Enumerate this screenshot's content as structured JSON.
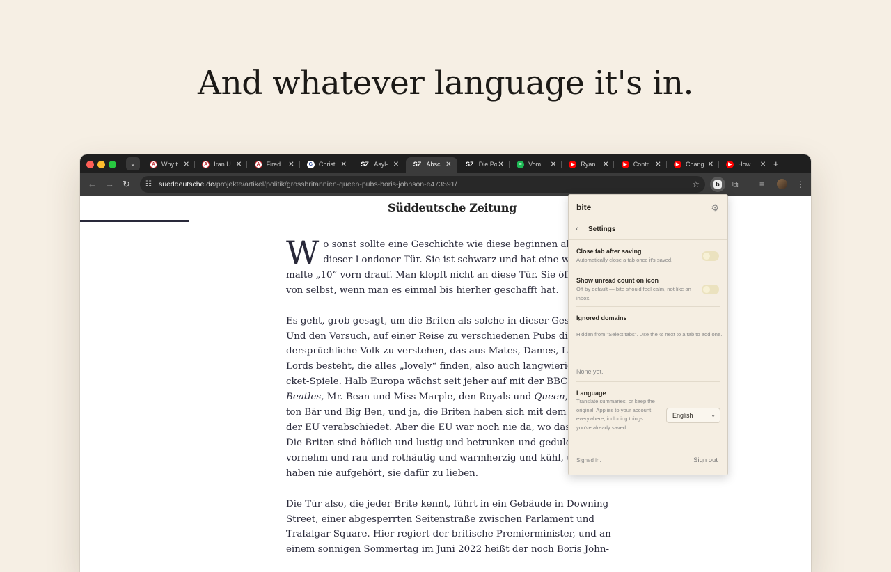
{
  "headline": "And whatever language it's in.",
  "browser": {
    "tabs": [
      {
        "title": "Why t",
        "icon": "sz-red-icon",
        "icon_color": "#c1272d",
        "glyph": "A"
      },
      {
        "title": "Iran U",
        "icon": "sz-red-icon",
        "icon_color": "#c1272d",
        "glyph": "A"
      },
      {
        "title": "Fired",
        "icon": "sz-red-icon",
        "icon_color": "#c1272d",
        "glyph": "A"
      },
      {
        "title": "Christ",
        "icon": "g-icon",
        "icon_color": "#2b4c9b",
        "glyph": "G"
      },
      {
        "title": "Asyl-",
        "icon": "sz-icon",
        "icon_color": "#ffffff",
        "glyph": "SZ"
      },
      {
        "title": "Abscl",
        "icon": "sz-icon",
        "icon_color": "#ffffff",
        "glyph": "SZ",
        "active": true
      },
      {
        "title": "Die Po",
        "icon": "sz-icon",
        "icon_color": "#ffffff",
        "glyph": "SZ"
      },
      {
        "title": "Vom",
        "icon": "spotify-icon",
        "icon_color": "#1db954",
        "glyph": "≡"
      },
      {
        "title": "Ryan",
        "icon": "youtube-icon",
        "icon_color": "#ff0000",
        "glyph": "▶"
      },
      {
        "title": "Contr",
        "icon": "youtube-icon",
        "icon_color": "#ff0000",
        "glyph": "▶"
      },
      {
        "title": "Chang",
        "icon": "youtube-icon",
        "icon_color": "#ff0000",
        "glyph": "▶"
      },
      {
        "title": "How",
        "icon": "youtube-icon",
        "icon_color": "#ff0000",
        "glyph": "▶"
      }
    ],
    "url_domain": "sueddeutsche.de",
    "url_path": "/projekte/artikel/politik/grossbritannien-queen-pubs-boris-johnson-e473591/"
  },
  "page": {
    "logo": "Süddeutsche Zeitung",
    "dropcap": "W",
    "paragraphs": [
      {
        "lines": [
          {
            "segs": [
              {
                "t": "o sonst sollte eine Geschichte wie diese beginnen als h"
              }
            ]
          },
          {
            "segs": [
              {
                "t": "dieser Londoner Tür. Sie ist schwarz und hat eine weiß"
              }
            ]
          },
          {
            "segs": [
              {
                "t": "malte „10“ vorn drauf. Man klopft nicht an diese Tür. Sie öffn"
              }
            ]
          },
          {
            "segs": [
              {
                "t": "von selbst, wenn man es einmal bis hierher geschafft hat."
              }
            ]
          }
        ]
      },
      {
        "lines": [
          {
            "segs": [
              {
                "t": "Es geht, grob gesagt, um die Briten als solche in dieser Geschi"
              }
            ]
          },
          {
            "segs": [
              {
                "t": "Und den Versuch, auf einer Reise zu verschiedenen Pubs diese"
              }
            ]
          },
          {
            "segs": [
              {
                "t": "dersprüchliche Volk zu verstehen, das aus Mates, Dames, Lad"
              }
            ]
          },
          {
            "segs": [
              {
                "t": "Lords besteht, die alles „lovely“ finden, also auch langwierige"
              }
            ]
          },
          {
            "segs": [
              {
                "t": "cket-Spiele. Halb Europa wächst seit jeher auf mit der BBC un"
              }
            ]
          },
          {
            "segs": [
              {
                "t": "Beatles",
                "i": true
              },
              {
                "t": ", Mr. Bean und Miss Marple, den Royals und "
              },
              {
                "t": "Queen",
                "i": true
              },
              {
                "t": ", Pa"
              }
            ]
          },
          {
            "segs": [
              {
                "t": "ton Bär und Big Ben, und ja, die Briten haben sich mit dem Br"
              }
            ]
          },
          {
            "segs": [
              {
                "t": "der EU verabschiedet. Aber die EU war noch nie da, wo das He"
              }
            ]
          },
          {
            "segs": [
              {
                "t": "Die Briten sind höflich und lustig und betrunken und geduldi"
              }
            ]
          },
          {
            "segs": [
              {
                "t": "vornehm und rau und rothäutig und warmherzig und kühl, u"
              }
            ]
          },
          {
            "segs": [
              {
                "t": "haben nie aufgehört, sie dafür zu lieben."
              }
            ]
          }
        ]
      },
      {
        "lines": [
          {
            "segs": [
              {
                "t": "Die Tür also, die jeder Brite kennt, führt in ein Gebäude in Downing"
              }
            ]
          },
          {
            "segs": [
              {
                "t": "Street, einer abgesperrten Seitenstraße zwischen Parlament und"
              }
            ]
          },
          {
            "segs": [
              {
                "t": "Trafalgar Square. Hier regiert der britische Premierminister, und an"
              }
            ]
          },
          {
            "segs": [
              {
                "t": "einem sonnigen Sommertag im Juni 2022 heißt der noch Boris John-"
              }
            ]
          }
        ]
      }
    ]
  },
  "popup": {
    "brand": "bite",
    "back_label": "Settings",
    "close_tab": {
      "title": "Close tab after saving",
      "desc": "Automatically close a tab once it's saved.",
      "enabled": false
    },
    "unread": {
      "title": "Show unread count on icon",
      "desc": "Off by default — bite should feel calm, not like an inbox.",
      "enabled": false
    },
    "ignored": {
      "title": "Ignored domains",
      "desc": "Hidden from \"Select tabs\". Use the ⊘ next to a tab to add one.",
      "empty": "None yet."
    },
    "language": {
      "title": "Language",
      "desc": "Translate summaries, or keep the original. Applies to your account everywhere, including things you've already saved.",
      "selected": "English"
    },
    "signed_in": "Signed in.",
    "sign_out": "Sign out"
  }
}
